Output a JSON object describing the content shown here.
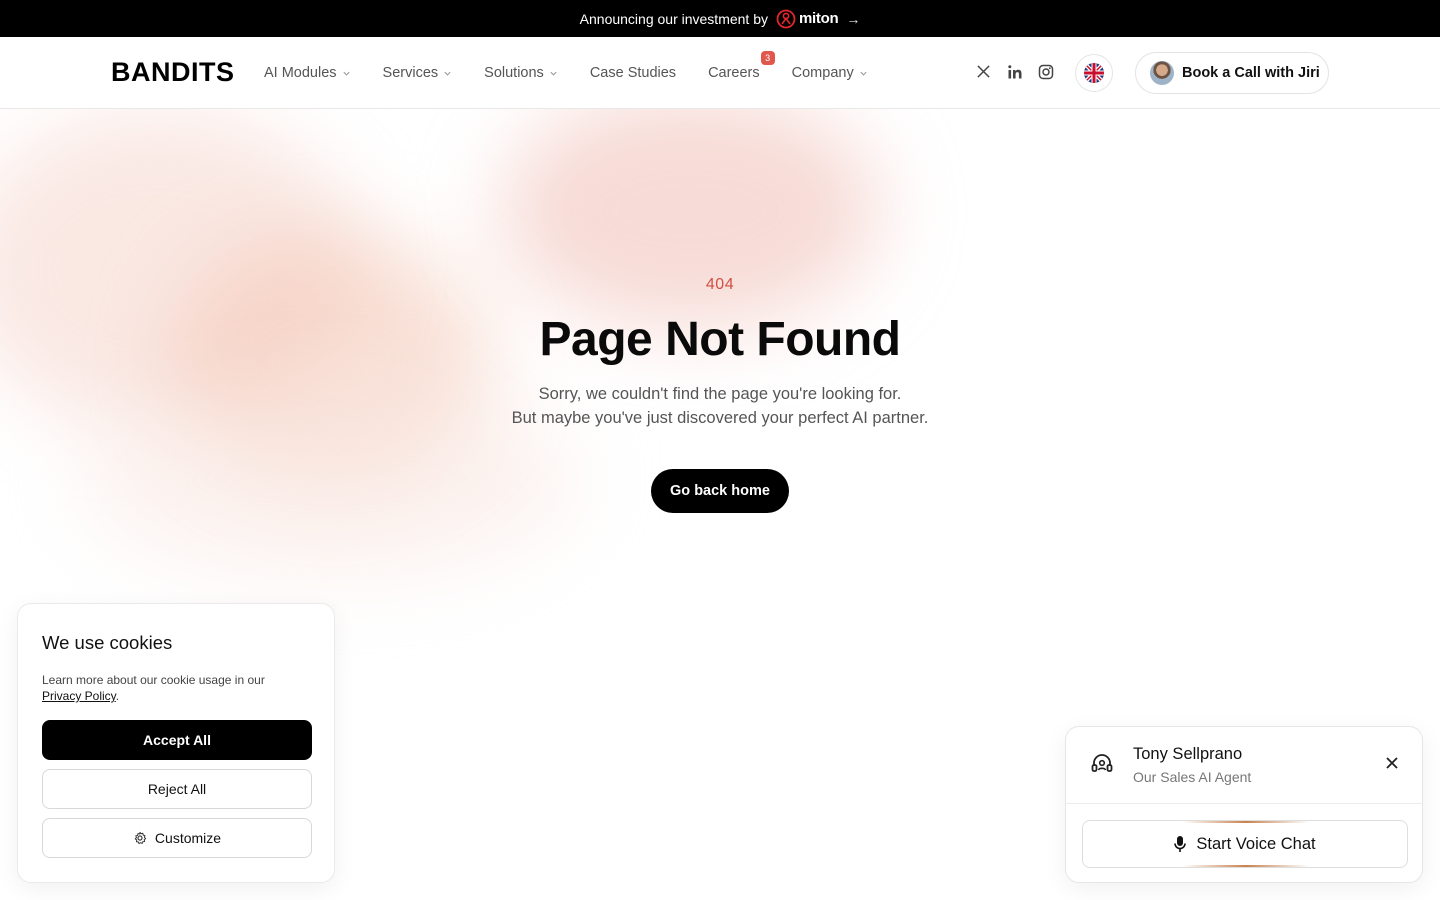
{
  "announcement": {
    "text": "Announcing our investment by",
    "brand": "miton",
    "brand_color": "#e3262b"
  },
  "header": {
    "logo": "BANDITS",
    "nav": [
      {
        "label": "AI Modules",
        "dropdown": true
      },
      {
        "label": "Services",
        "dropdown": true
      },
      {
        "label": "Solutions",
        "dropdown": true
      },
      {
        "label": "Case Studies",
        "dropdown": false
      },
      {
        "label": "Careers",
        "dropdown": false,
        "badge": "3"
      },
      {
        "label": "Company",
        "dropdown": true
      }
    ],
    "social_icons": [
      "x-icon",
      "linkedin-icon",
      "instagram-icon"
    ],
    "language_icon": "uk-flag-icon",
    "cta": "Book a Call with Jiri"
  },
  "error": {
    "code": "404",
    "title": "Page Not Found",
    "line1": "Sorry, we couldn't find the page you're looking for.",
    "line2": "But maybe you've just discovered your perfect AI partner.",
    "button": "Go back home",
    "code_color": "#d14f43"
  },
  "cookie": {
    "title": "We use cookies",
    "text": "Learn more about our cookie usage in our",
    "link": "Privacy Policy",
    "accept": "Accept All",
    "reject": "Reject All",
    "customize": "Customize"
  },
  "agent": {
    "name": "Tony Sellprano",
    "role": "Our Sales AI Agent",
    "button": "Start Voice Chat"
  }
}
